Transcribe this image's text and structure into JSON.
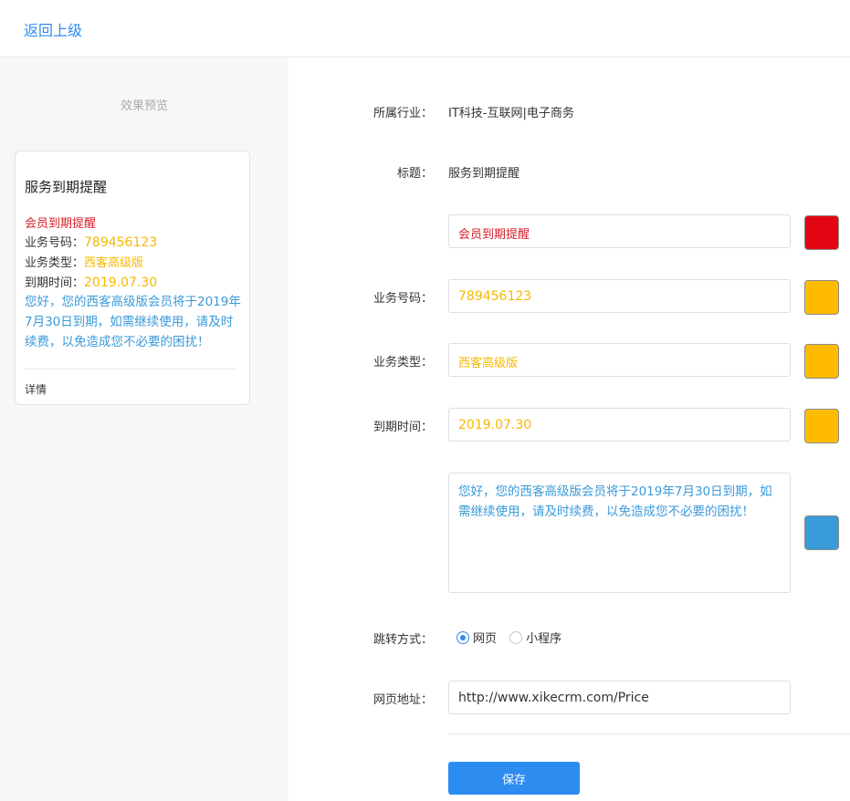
{
  "header": {
    "back_label": "返回上级"
  },
  "colors": {
    "red": "#d8202a",
    "orange": "#f5b800",
    "blue": "#3a9ad9",
    "accent": "#2d8cf0",
    "swatch_red": "#e30613",
    "swatch_orange": "#ffbb00",
    "swatch_blue": "#3a9bd9"
  },
  "preview": {
    "title": "效果预览",
    "card": {
      "title": "服务到期提醒",
      "first": "会员到期提醒",
      "code_label": "业务号码：",
      "code_value": "789456123",
      "type_label": "业务类型：",
      "type_value": "西客高级版",
      "expire_label": "到期时间：",
      "expire_value": "2019.07.30",
      "message": "您好，您的西客高级版会员将于2019年7月30日到期，如需继续使用，请及时续费，以免造成您不必要的困扰！",
      "detail": "详情"
    }
  },
  "form": {
    "industry_label": "所属行业：",
    "industry_value": "IT科技-互联网|电子商务",
    "title_label": "标题：",
    "title_value": "服务到期提醒",
    "first_value": "会员到期提醒",
    "code_label": "业务号码：",
    "code_value": "789456123",
    "type_label": "业务类型：",
    "type_value": "西客高级版",
    "expire_label": "到期时间：",
    "expire_value": "2019.07.30",
    "remark_value": "您好，您的西客高级版会员将于2019年7月30日到期，如需继续使用，请及时续费，以免造成您不必要的困扰！",
    "jump_label": "跳转方式：",
    "jump_options": [
      {
        "label": "网页",
        "selected": true
      },
      {
        "label": "小程序",
        "selected": false
      }
    ],
    "url_label": "网页地址：",
    "url_value": "http://www.xikecrm.com/Price",
    "save_label": "保存"
  }
}
